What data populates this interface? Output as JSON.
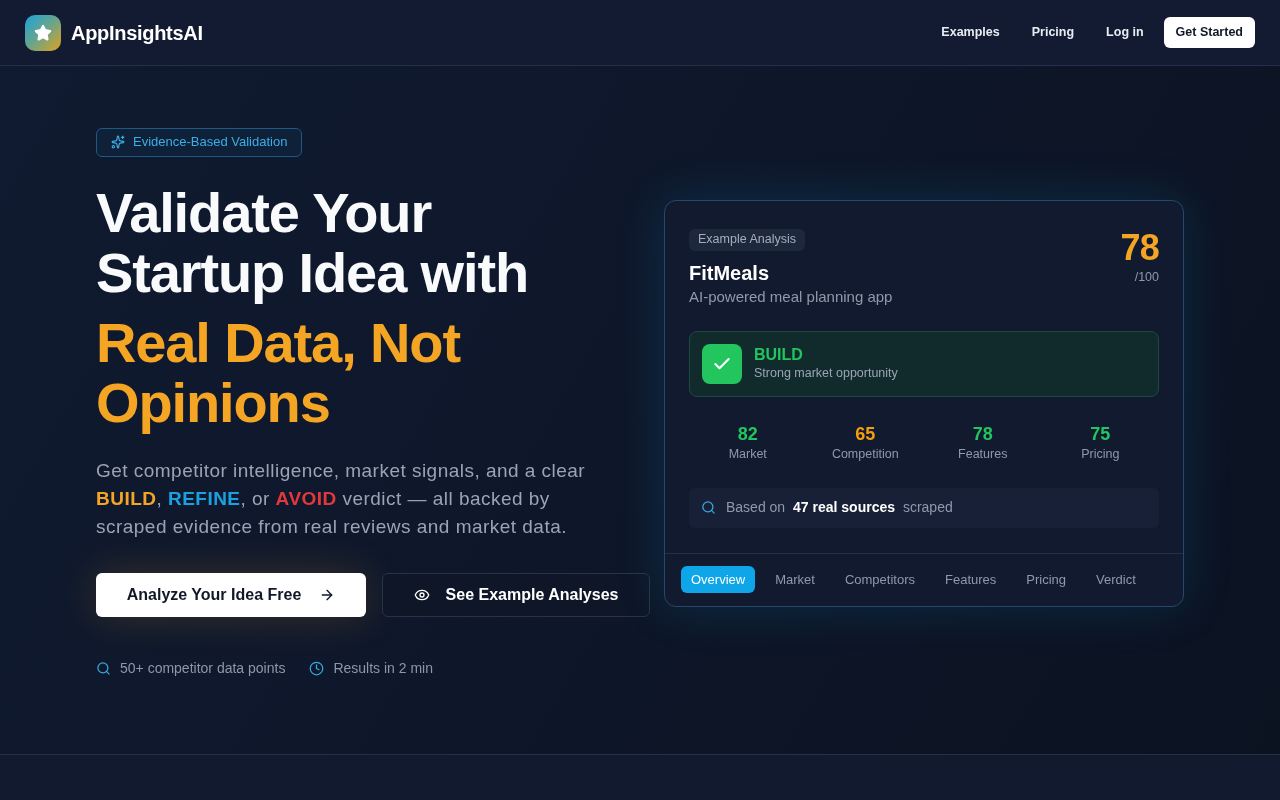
{
  "nav": {
    "brand": "AppInsightsAI",
    "links": [
      "Examples",
      "Pricing",
      "Log in"
    ],
    "cta": "Get Started"
  },
  "hero": {
    "badge": "Evidence-Based Validation",
    "title_lines": [
      "Validate Your",
      "Startup Idea with"
    ],
    "title_highlight_lines": [
      "Real Data, Not",
      "Opinions"
    ],
    "description": [
      {
        "text": "Get competitor intelligence, market signals, and a clear "
      },
      {
        "text": "BUILD",
        "color": "#f5a524"
      },
      {
        "text": ", "
      },
      {
        "text": "REFINE",
        "color": "#1ba1e2"
      },
      {
        "text": ", or "
      },
      {
        "text": "AVOID",
        "color": "#e0383b"
      },
      {
        "text": " verdict — all backed by scraped evidence from real reviews and market data."
      }
    ],
    "primary_button": "Analyze Your Idea Free",
    "secondary_button": "See Example Analyses",
    "features": [
      {
        "kind": "search",
        "text": "50+ competitor data points"
      },
      {
        "kind": "clock",
        "text": "Results in 2 min"
      }
    ]
  },
  "example_card": {
    "badge": "Example Analysis",
    "app_name": "FitMeals",
    "app_description": "AI-powered meal planning app",
    "score": "78",
    "score_max": "/100",
    "verdict": {
      "kind": "build",
      "label": "BUILD",
      "note": "Strong market opportunity"
    },
    "metrics": [
      {
        "value": "82",
        "label": "Market",
        "color": "#22c55e"
      },
      {
        "value": "65",
        "label": "Competition",
        "color": "#f59e0b"
      },
      {
        "value": "78",
        "label": "Features",
        "color": "#22c55e"
      },
      {
        "value": "75",
        "label": "Pricing",
        "color": "#22c55e"
      }
    ],
    "sources_note": "Based on **47 real sources** scraped",
    "tabs": [
      {
        "label": "Overview",
        "selected": true
      },
      {
        "label": "Market",
        "selected": false
      },
      {
        "label": "Competitors",
        "selected": false
      },
      {
        "label": "Features",
        "selected": false
      },
      {
        "label": "Pricing",
        "selected": false
      },
      {
        "label": "Verdict",
        "selected": false
      }
    ]
  }
}
